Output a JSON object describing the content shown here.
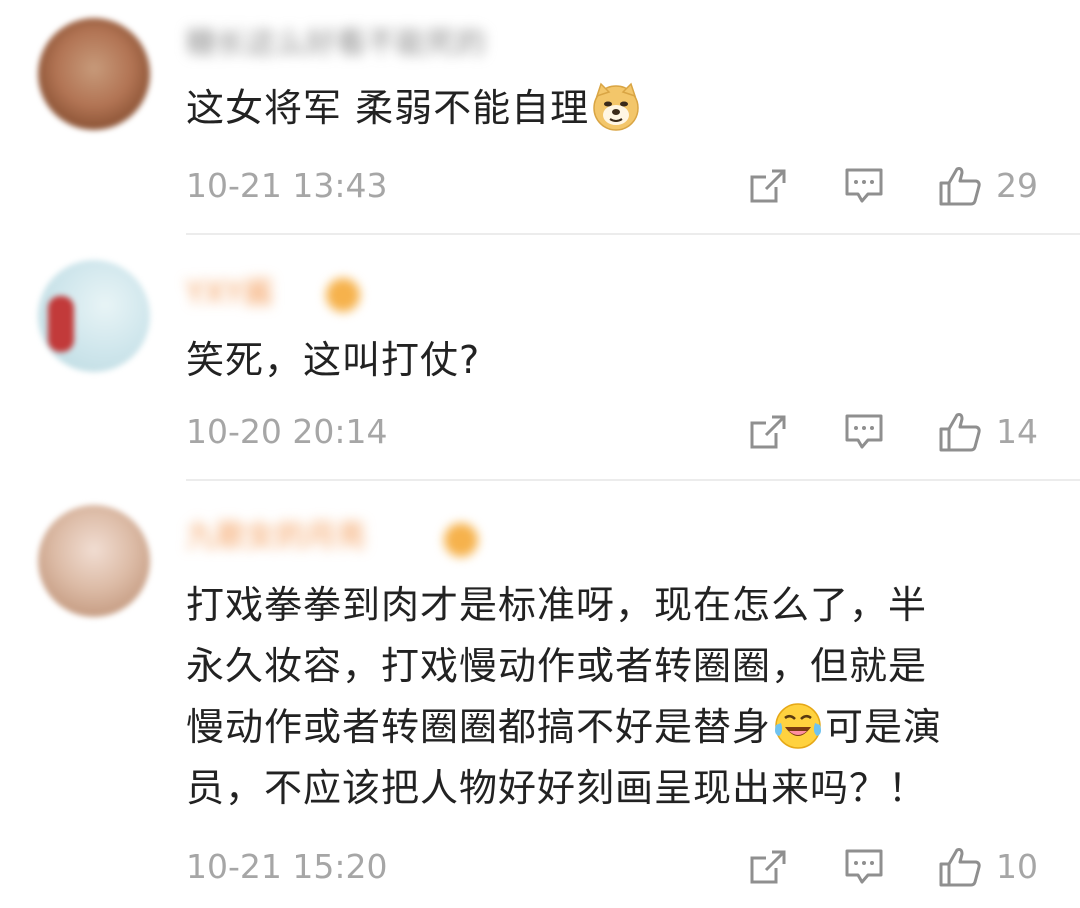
{
  "comments": [
    {
      "username": "糖长这么好看不能死的",
      "text": "这女将军 柔弱不能自理",
      "emoji": "doge-emoji",
      "time": "10-21 13:43",
      "likes": "29"
    },
    {
      "username": "YXY酱",
      "text": "笑死，这叫打仗?",
      "time": "10-20 20:14",
      "likes": "14"
    },
    {
      "username": "九歌女的月亮",
      "text_lines": [
        "打戏拳拳到肉才是标准呀，现在怎么了，半",
        "永久妆容，打戏慢动作或者转圈圈，但就是",
        "慢动作或者转圈圈都搞不好是替身",
        "可是演",
        "员，不应该把人物好好刻画呈现出来吗？！"
      ],
      "emoji": "laugh-cry-emoji",
      "time": "10-21 15:20",
      "likes": "10"
    }
  ],
  "icons": {
    "share": "share-icon",
    "reply": "comment-icon",
    "like": "thumbs-up-icon"
  },
  "colors": {
    "meta_gray": "#a6a6a6",
    "text": "#222222",
    "divider": "#ececec",
    "username_orange": "#f39a56"
  }
}
